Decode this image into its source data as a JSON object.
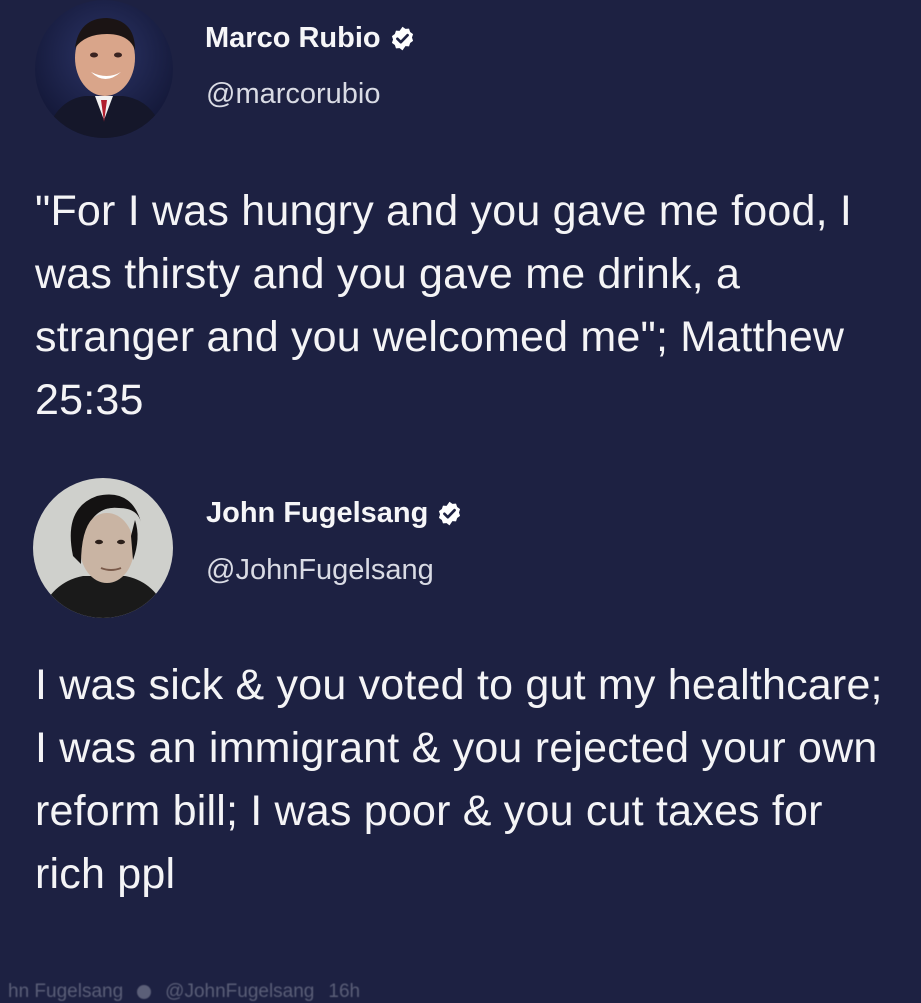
{
  "tweets": [
    {
      "author": {
        "name": "Marco Rubio",
        "handle": "@marcorubio",
        "verified": true,
        "avatar_icon": "profile-photo-man-smiling-dark-suit"
      },
      "text": "\"For I was hungry and you gave me food, I was thirsty and you gave me drink, a stranger and you welcomed me\"; Matthew 25:35"
    },
    {
      "author": {
        "name": "John Fugelsang",
        "handle": "@JohnFugelsang",
        "verified": true,
        "avatar_icon": "profile-photo-man-dark-hair"
      },
      "text": "I was sick & you voted to gut my healthcare; I was an immigrant & you rejected your own reform bill; I was poor & you cut taxes for rich ppl",
      "footer": {
        "name": "hn Fugelsang",
        "handle": "@JohnFugelsang",
        "time": "16h"
      }
    }
  ],
  "colors": {
    "background": "#1d2142",
    "text": "#f4f4f6",
    "verified_badge": "#ffffff"
  }
}
